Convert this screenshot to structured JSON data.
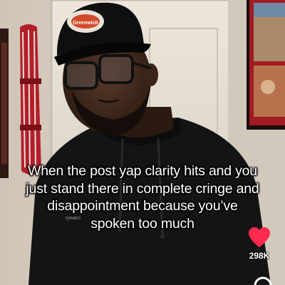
{
  "video": {
    "caption_lines": [
      "When the post yap clarity hits and you",
      "just stand there in complete cringe and",
      "disappointment because you’ve",
      "spoken too much"
    ],
    "hat_logo_text": "Greenwich",
    "shirt_text": "rywaro"
  },
  "actions": {
    "like_icon": "heart-icon",
    "like_count": "298K",
    "like_color": "#ff2a4f",
    "next_icon": "circle-icon"
  }
}
